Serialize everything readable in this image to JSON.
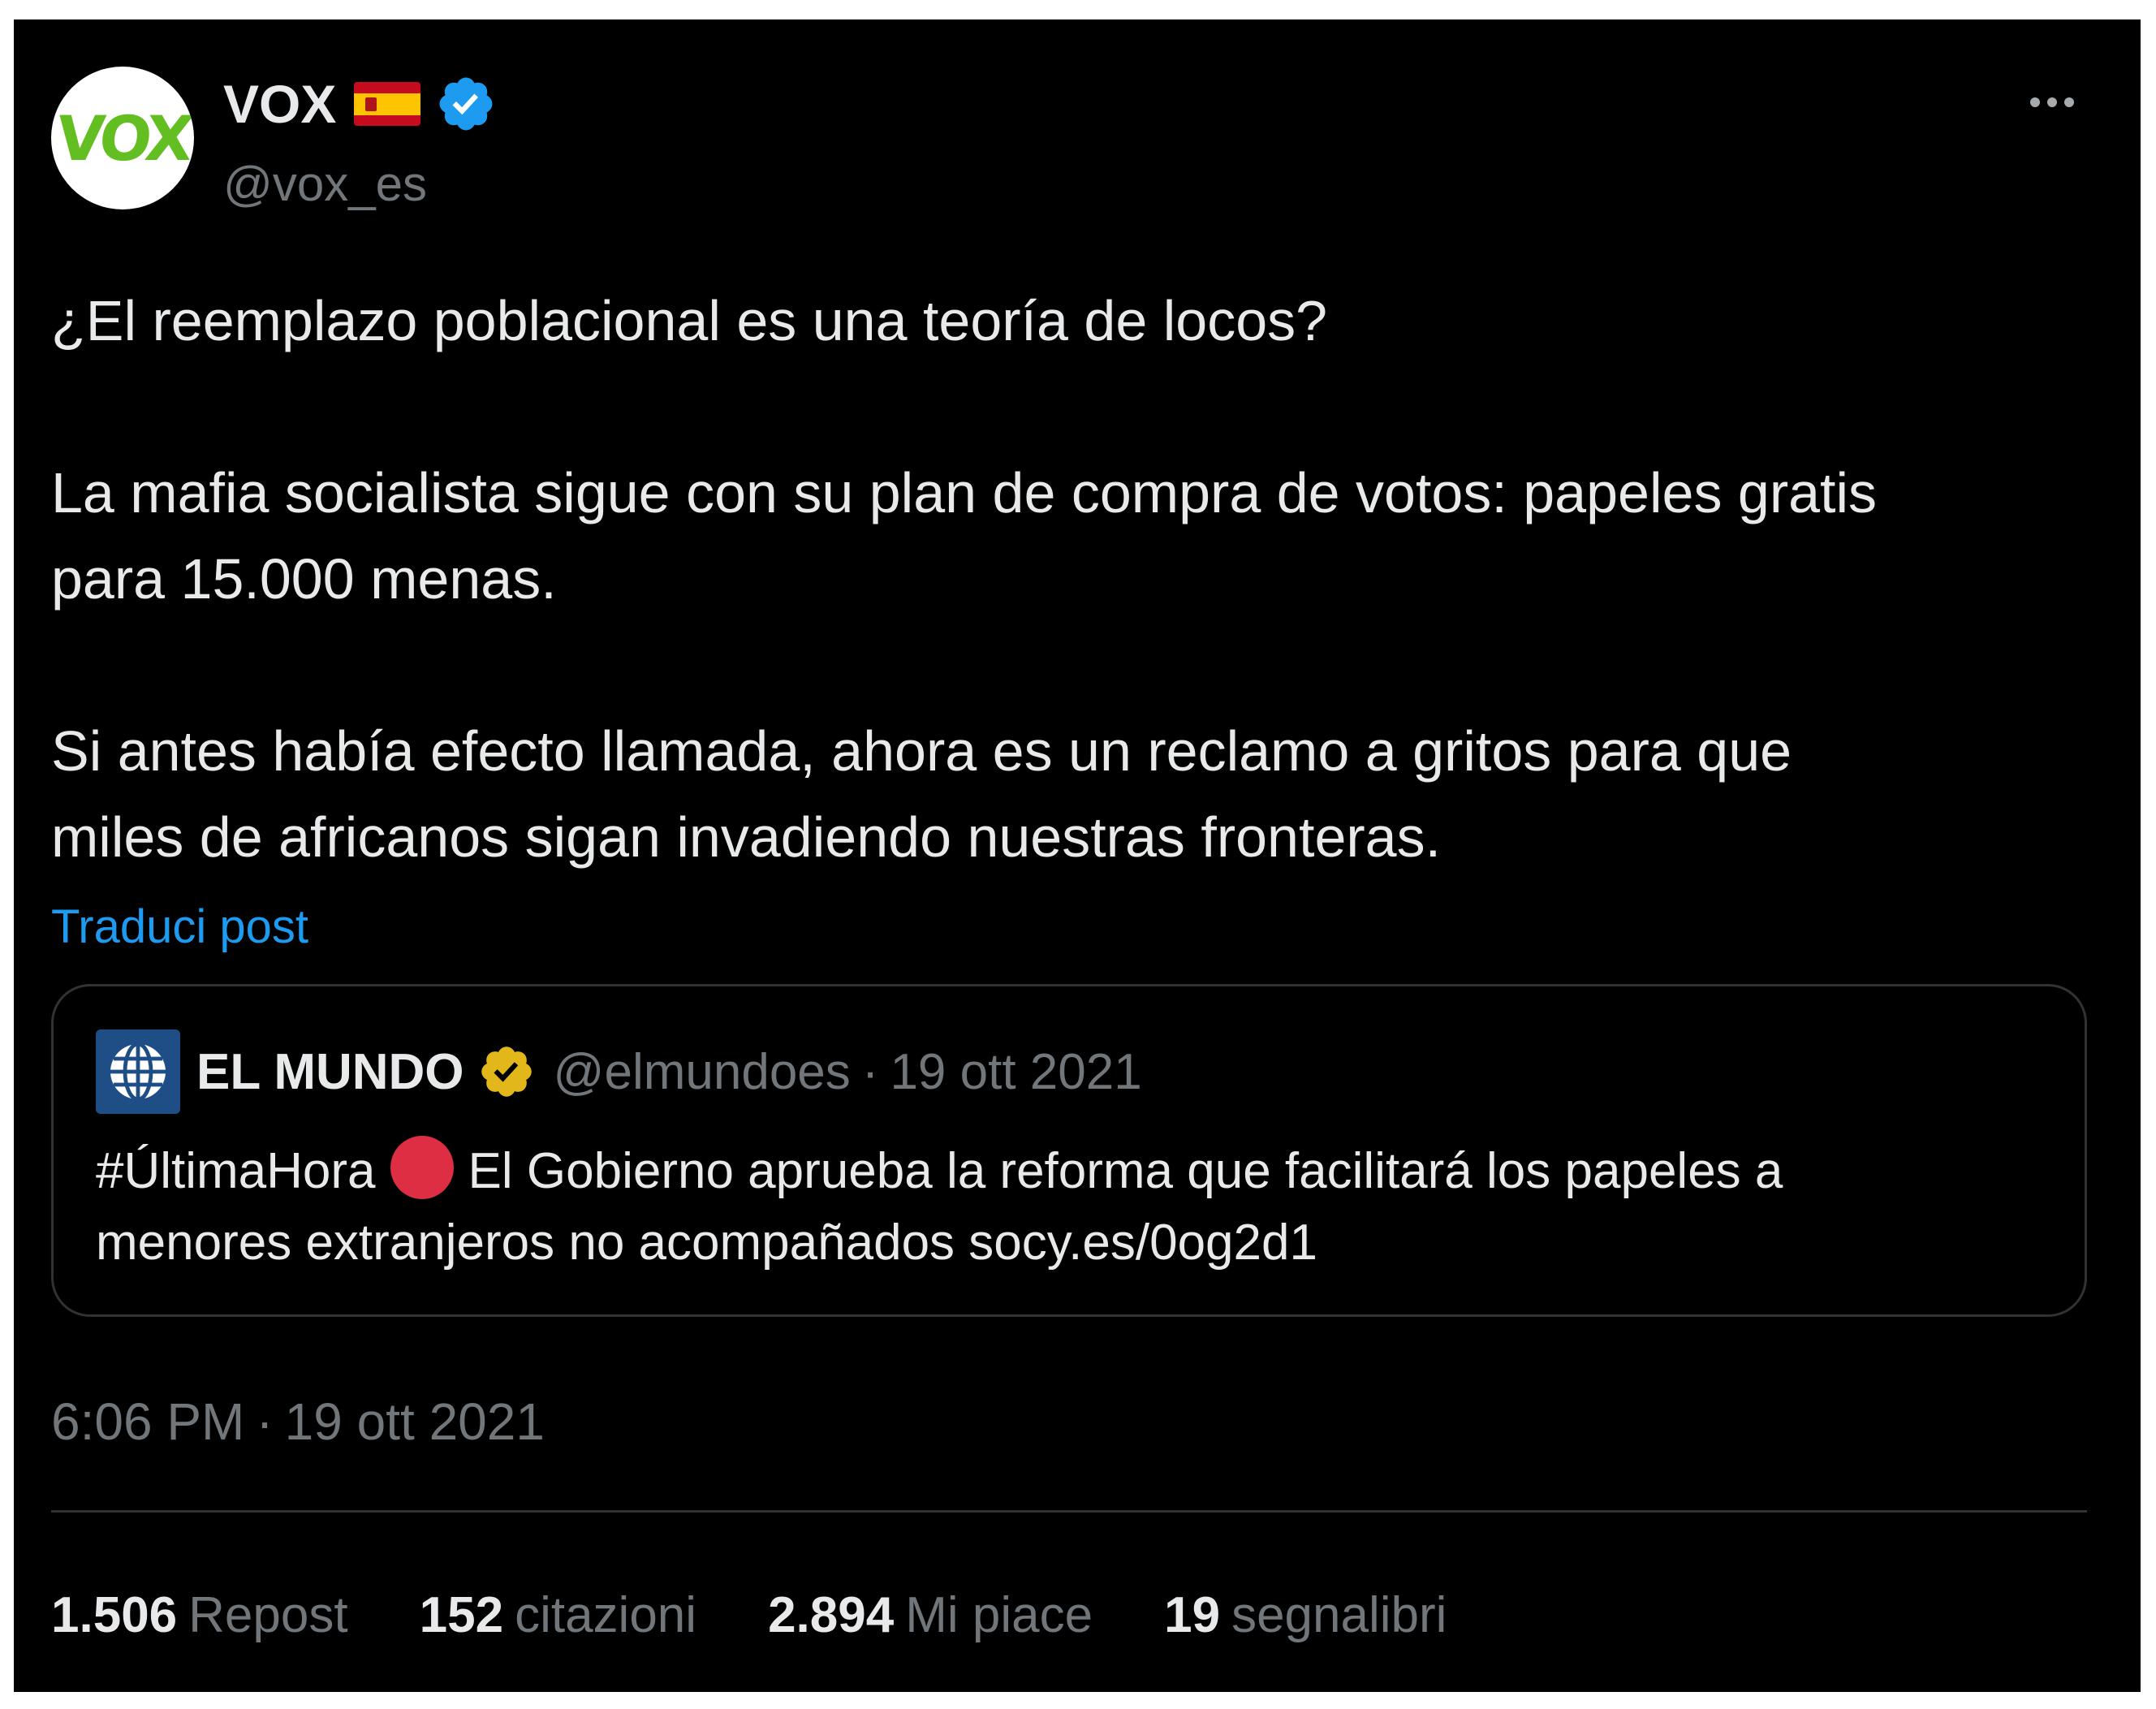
{
  "author": {
    "display_name": "VOX",
    "handle": "@vox_es",
    "avatar_text": "VOX",
    "flag_icon": "spain-flag-icon",
    "verified_icon": "blue-verified-badge-icon",
    "verified_color": "#1d9bf0"
  },
  "post": {
    "lines": [
      "¿El reemplazo poblacional es una teoría de locos?",
      "",
      "La mafia socialista sigue con su plan de compra de votos: papeles gratis",
      "para 15.000 menas.",
      "",
      "Si antes había efecto llamada, ahora es un reclamo a gritos para que",
      "miles de africanos sigan invadiendo nuestras fronteras."
    ],
    "translate_label": "Traduci post"
  },
  "quote": {
    "display_name": "EL MUNDO",
    "handle": "@elmundoes",
    "separator": "·",
    "date": "19 ott 2021",
    "badge_icon": "gold-verified-badge-icon",
    "badge_color": "#e2b719",
    "avatar_icon": "el-mundo-globe-icon",
    "text_hashtag": "#ÚltimaHora",
    "red_circle_icon": "red-circle-icon",
    "text_line1_rest": "El Gobierno aprueba la reforma que facilitará los papeles a",
    "text_line2": "menores extranjeros no acompañados socy.es/0og2d1"
  },
  "meta": {
    "time": "6:06 PM",
    "separator": "·",
    "date": "19 ott 2021"
  },
  "stats": [
    {
      "value": "1.506",
      "label": "Repost"
    },
    {
      "value": "152",
      "label": "citazioni"
    },
    {
      "value": "2.894",
      "label": "Mi piace"
    },
    {
      "value": "19",
      "label": "segnalibri"
    }
  ],
  "more_icon": "more-options-icon",
  "colors": {
    "background": "#000000",
    "text": "#e7e9ea",
    "secondary_text": "#71767b",
    "link": "#1d9bf0",
    "border": "#2f3336",
    "vox_green": "#63be21"
  }
}
